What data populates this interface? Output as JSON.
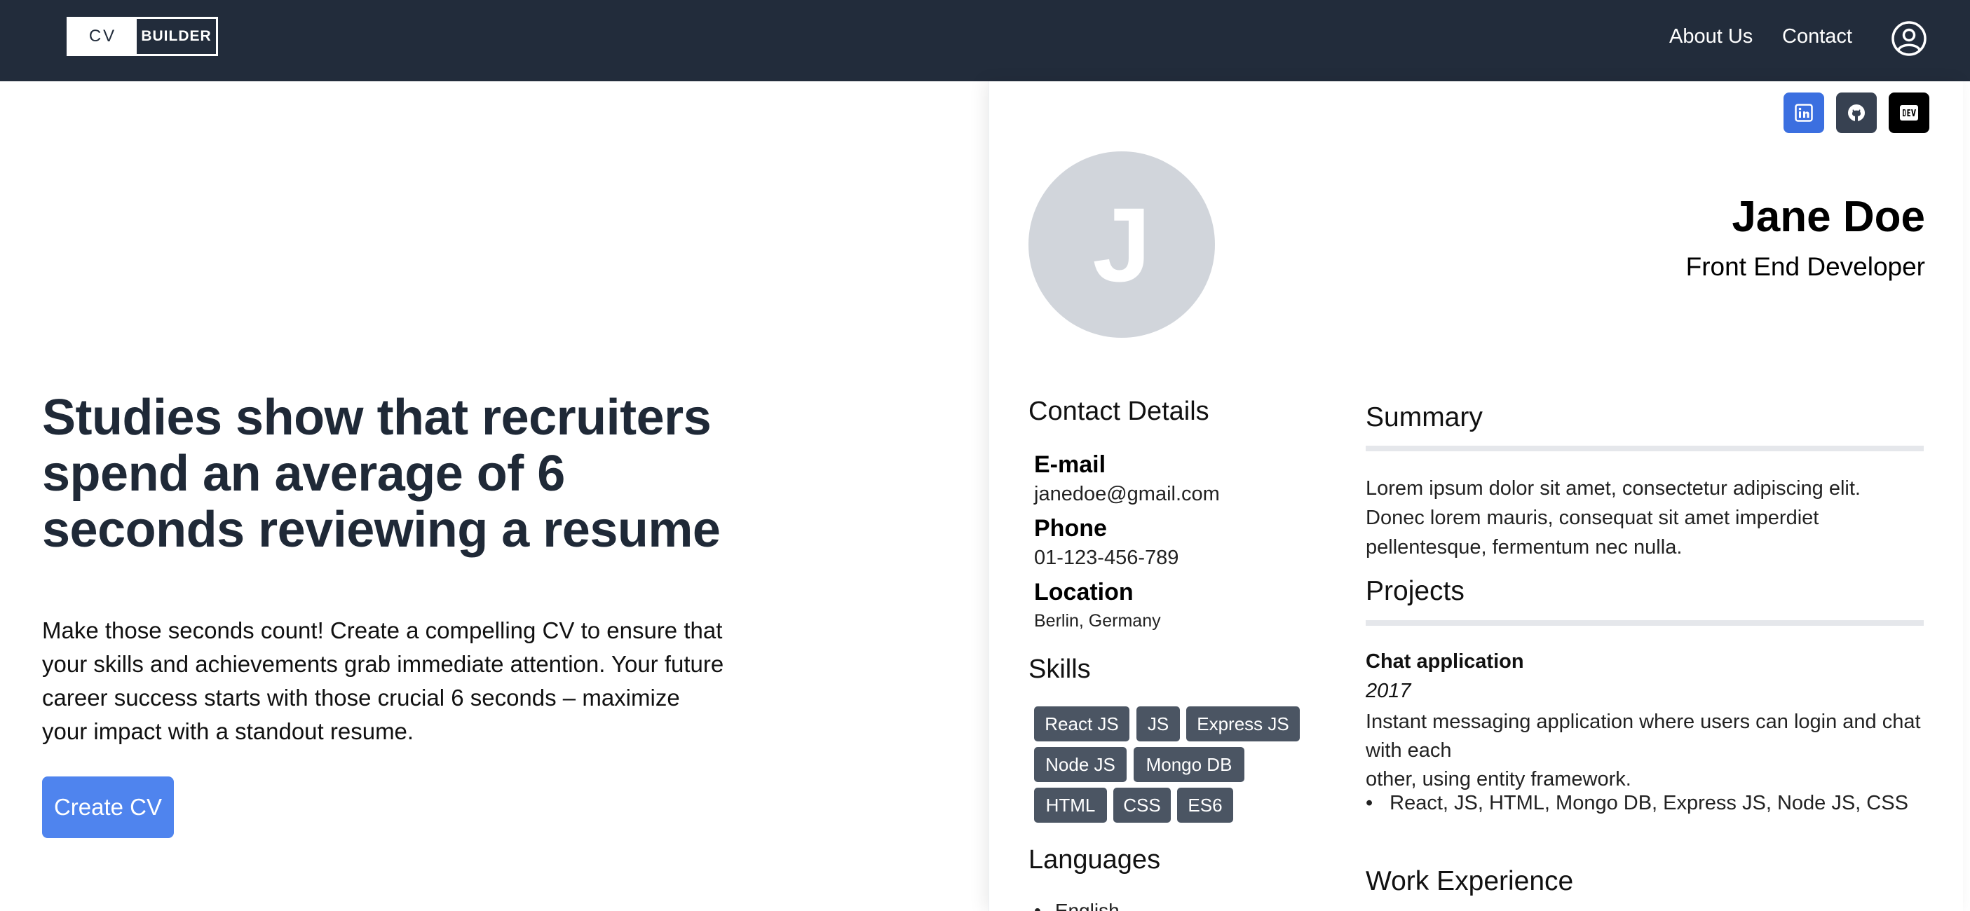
{
  "navbar": {
    "logo_left": "CV",
    "logo_right": "BUILDER",
    "links": [
      "About Us",
      "Contact"
    ],
    "user_icon": "user-circle-icon"
  },
  "hero": {
    "title": "Studies show that recruiters spend an average of 6 seconds reviewing a resume",
    "text": "Make those seconds count! Create a compelling CV to ensure that your skills and achievements grab immediate attention. Your future career success starts with those crucial 6 seconds – maximize your impact with a standout resume.",
    "cta": "Create CV"
  },
  "cv": {
    "social": [
      "linkedin-icon",
      "github-icon",
      "dev-icon"
    ],
    "avatar_letter": "J",
    "name": "Jane Doe",
    "role": "Front End Developer",
    "contact_heading": "Contact Details",
    "email_label": "E-mail",
    "email": "janedoe@gmail.com",
    "phone_label": "Phone",
    "phone": "01-123-456-789",
    "location_label": "Location",
    "location": "Berlin, Germany",
    "skills_heading": "Skills",
    "skills": [
      "React JS",
      "JS",
      "Express JS",
      "Node JS",
      "Mongo DB",
      "HTML",
      "CSS",
      "ES6"
    ],
    "languages_heading": "Languages",
    "languages": [
      "English"
    ],
    "summary_heading": "Summary",
    "summary": "Lorem ipsum dolor sit amet, consectetur adipiscing elit. Donec lorem mauris, consequat sit amet imperdiet pellentesque, fermentum nec nulla.",
    "projects_heading": "Projects",
    "project": {
      "title": "Chat application",
      "year": "2017",
      "description": "Instant messaging application where users can login and chat with each\nother, using entity framework.",
      "tech": "React, JS, HTML, Mongo DB, Express JS, Node JS, CSS"
    },
    "work_heading": "Work Experience"
  },
  "colors": {
    "navbar": "#222c3b",
    "button": "#4f84ee",
    "tag": "#4b5563",
    "linkedin": "#3b6fe0",
    "github": "#374151",
    "dev": "#000000"
  }
}
